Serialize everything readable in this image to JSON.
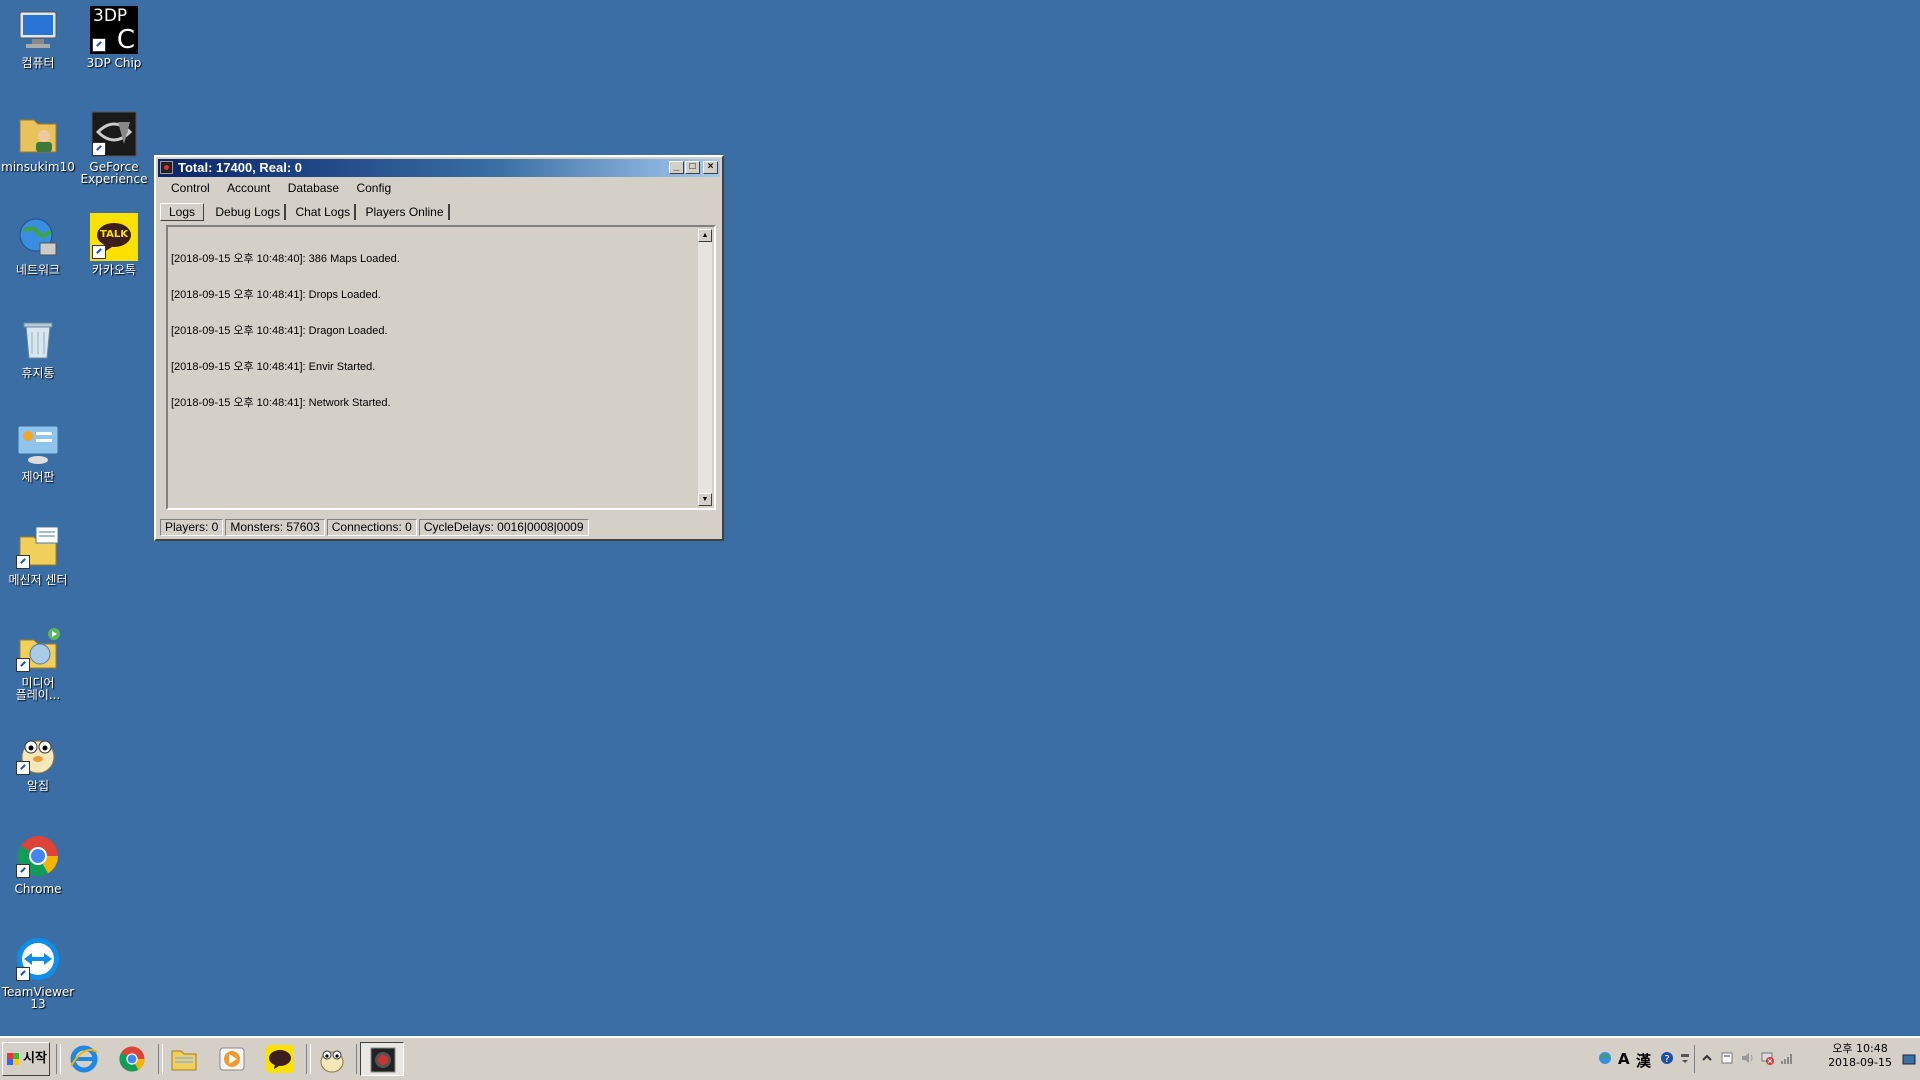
{
  "desktop": {
    "icons": [
      {
        "label": "컴퓨터"
      },
      {
        "label": "3DP Chip"
      },
      {
        "label": "minsukim10"
      },
      {
        "label": "GeForce\nExperience"
      },
      {
        "label": "네트워크"
      },
      {
        "label": "카카오톡"
      },
      {
        "label": "휴지통"
      },
      {
        "label": "제어판"
      },
      {
        "label": "메신저 센터"
      },
      {
        "label": "미디어\n플레이..."
      },
      {
        "label": "알집"
      },
      {
        "label": "Chrome"
      },
      {
        "label": "TeamViewer\n13"
      }
    ],
    "icon_3dp_text": "3DP",
    "icon_3dp_letter": "C",
    "icon_kakao_text": "TALK"
  },
  "window": {
    "title": "Total: 17400, Real: 0",
    "buttons": {
      "minimize": "_",
      "maximize": "□",
      "close": "×"
    },
    "menu": [
      "Control",
      "Account",
      "Database",
      "Config"
    ],
    "tabs": [
      "Logs",
      "Debug Logs",
      "Chat Logs",
      "Players Online"
    ],
    "active_tab": "Logs",
    "log_lines": [
      "[2018-09-15 오후 10:48:40]: 386 Maps Loaded.",
      "[2018-09-15 오후 10:48:41]: Drops Loaded.",
      "[2018-09-15 오후 10:48:41]: Dragon Loaded.",
      "[2018-09-15 오후 10:48:41]: Envir Started.",
      "[2018-09-15 오후 10:48:41]: Network Started."
    ],
    "status": {
      "players": "Players: 0",
      "monsters": "Monsters: 57603",
      "connections": "Connections: 0",
      "cycle_delays": "CycleDelays: 0016|0008|0009"
    }
  },
  "taskbar": {
    "start_label": "시작",
    "apps": [
      "internet-explorer",
      "chrome",
      "file-explorer",
      "media-player",
      "kakaotalk",
      "alzip",
      "server-app"
    ],
    "tray": {
      "ime_a": "A",
      "ime_han": "漢",
      "time": "오후 10:48",
      "date": "2018-09-15"
    }
  },
  "colors": {
    "desktop_bg": "#3a6ea5",
    "title_gradient_start": "#0a246a",
    "window_face": "#d4d0c8"
  }
}
